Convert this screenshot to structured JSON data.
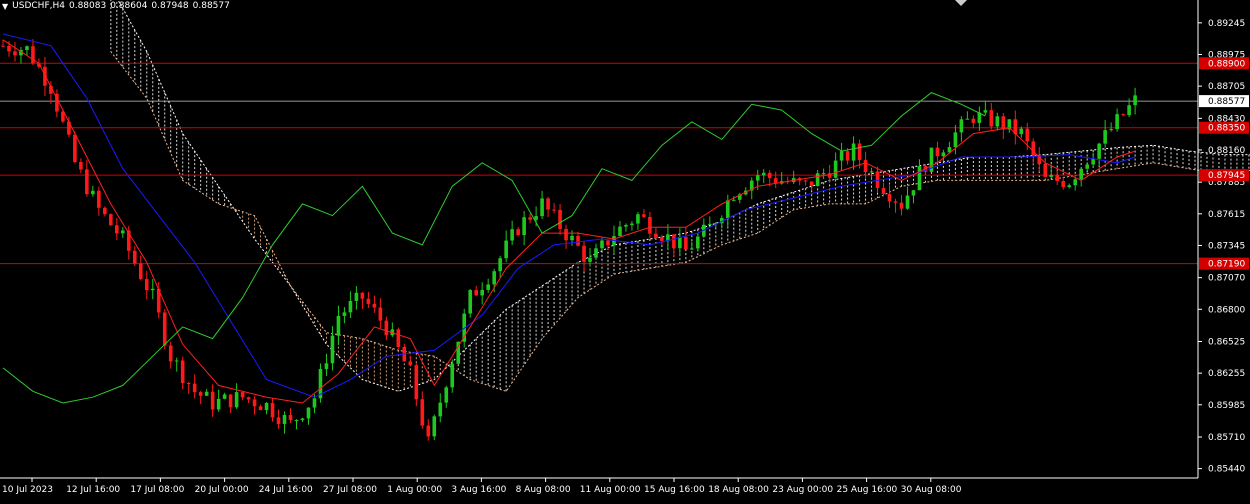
{
  "header": {
    "symbol": "USDCHF,H4",
    "open": "0.88083",
    "high": "0.88604",
    "low": "0.87948",
    "close": "0.88577"
  },
  "colors": {
    "background": "#000000",
    "bull_candle": "#1ec81e",
    "bear_candle": "#ff1a1a",
    "tenkan": "#ff2020",
    "kijun": "#1a1aff",
    "chikou": "#2ecc2e",
    "cloud_a": "#ffffff",
    "cloud_b": "#f0b68a",
    "level_line": "#d40000",
    "current_price_line": "#c8c8c8",
    "axis": "#ffffff"
  },
  "chart_data": {
    "type": "candlestick",
    "symbol": "USDCHF",
    "timeframe": "H4",
    "ylim": [
      0.8536,
      0.8944
    ],
    "y_ticks": [
      "0.89245",
      "0.88975",
      "0.88705",
      "0.88430",
      "0.88160",
      "0.87885",
      "0.87615",
      "0.87345",
      "0.87070",
      "0.86800",
      "0.86525",
      "0.86255",
      "0.85985",
      "0.85710",
      "0.85440"
    ],
    "x_tick_labels": [
      "10 Jul 2023",
      "12 Jul 16:00",
      "17 Jul 08:00",
      "20 Jul 00:00",
      "24 Jul 16:00",
      "27 Jul 08:00",
      "1 Aug 00:00",
      "3 Aug 16:00",
      "8 Aug 08:00",
      "11 Aug 00:00",
      "15 Aug 16:00",
      "18 Aug 08:00",
      "23 Aug 00:00",
      "25 Aug 16:00",
      "30 Aug 08:00"
    ],
    "horizontal_levels": [
      {
        "label": "0.88900",
        "value": 0.889,
        "color": "#d40000"
      },
      {
        "label": "0.88350",
        "value": 0.8835,
        "color": "#d40000"
      },
      {
        "label": "0.87945",
        "value": 0.87945,
        "color": "#d40000"
      },
      {
        "label": "0.87190",
        "value": 0.8719,
        "color": "#d40000"
      }
    ],
    "current_price": {
      "label": "0.88577",
      "value": 0.88577
    },
    "price_path": [
      [
        0,
        0.8905
      ],
      [
        4,
        0.8902
      ],
      [
        8,
        0.887
      ],
      [
        12,
        0.8805
      ],
      [
        16,
        0.8765
      ],
      [
        20,
        0.874
      ],
      [
        25,
        0.869
      ],
      [
        28,
        0.864
      ],
      [
        32,
        0.861
      ],
      [
        35,
        0.86
      ],
      [
        40,
        0.8605
      ],
      [
        44,
        0.8598
      ],
      [
        48,
        0.8582
      ],
      [
        52,
        0.8605
      ],
      [
        56,
        0.8675
      ],
      [
        60,
        0.869
      ],
      [
        64,
        0.8665
      ],
      [
        68,
        0.8625
      ],
      [
        71,
        0.8565
      ],
      [
        74,
        0.862
      ],
      [
        78,
        0.869
      ],
      [
        82,
        0.8715
      ],
      [
        86,
        0.875
      ],
      [
        90,
        0.877
      ],
      [
        94,
        0.8745
      ],
      [
        98,
        0.872
      ],
      [
        102,
        0.8745
      ],
      [
        106,
        0.876
      ],
      [
        110,
        0.8745
      ],
      [
        114,
        0.873
      ],
      [
        118,
        0.875
      ],
      [
        122,
        0.878
      ],
      [
        126,
        0.8795
      ],
      [
        130,
        0.879
      ],
      [
        134,
        0.8785
      ],
      [
        138,
        0.88
      ],
      [
        142,
        0.8815
      ],
      [
        146,
        0.879
      ],
      [
        150,
        0.877
      ],
      [
        154,
        0.8805
      ],
      [
        158,
        0.8825
      ],
      [
        162,
        0.8845
      ],
      [
        166,
        0.884
      ],
      [
        170,
        0.883
      ],
      [
        174,
        0.879
      ],
      [
        178,
        0.879
      ],
      [
        182,
        0.8815
      ],
      [
        186,
        0.884
      ],
      [
        189,
        0.8858
      ]
    ],
    "tenkan": [
      [
        0,
        0.891
      ],
      [
        6,
        0.889
      ],
      [
        12,
        0.883
      ],
      [
        18,
        0.877
      ],
      [
        24,
        0.872
      ],
      [
        30,
        0.865
      ],
      [
        36,
        0.8615
      ],
      [
        44,
        0.8605
      ],
      [
        50,
        0.86
      ],
      [
        56,
        0.8625
      ],
      [
        62,
        0.8665
      ],
      [
        68,
        0.8655
      ],
      [
        72,
        0.8615
      ],
      [
        78,
        0.8665
      ],
      [
        84,
        0.8715
      ],
      [
        90,
        0.8745
      ],
      [
        96,
        0.8745
      ],
      [
        102,
        0.874
      ],
      [
        108,
        0.875
      ],
      [
        114,
        0.875
      ],
      [
        120,
        0.877
      ],
      [
        126,
        0.8785
      ],
      [
        132,
        0.879
      ],
      [
        138,
        0.8795
      ],
      [
        144,
        0.8805
      ],
      [
        150,
        0.879
      ],
      [
        156,
        0.8805
      ],
      [
        162,
        0.883
      ],
      [
        168,
        0.8835
      ],
      [
        174,
        0.8805
      ],
      [
        180,
        0.879
      ],
      [
        186,
        0.881
      ],
      [
        189,
        0.8815
      ]
    ],
    "kijun": [
      [
        0,
        0.8915
      ],
      [
        8,
        0.8905
      ],
      [
        14,
        0.886
      ],
      [
        20,
        0.88
      ],
      [
        26,
        0.876
      ],
      [
        32,
        0.872
      ],
      [
        38,
        0.867
      ],
      [
        44,
        0.862
      ],
      [
        52,
        0.8605
      ],
      [
        58,
        0.862
      ],
      [
        64,
        0.864
      ],
      [
        72,
        0.8645
      ],
      [
        80,
        0.8675
      ],
      [
        86,
        0.8715
      ],
      [
        92,
        0.8735
      ],
      [
        100,
        0.874
      ],
      [
        108,
        0.8735
      ],
      [
        116,
        0.8745
      ],
      [
        124,
        0.8765
      ],
      [
        132,
        0.8775
      ],
      [
        140,
        0.8785
      ],
      [
        146,
        0.879
      ],
      [
        152,
        0.8795
      ],
      [
        160,
        0.881
      ],
      [
        170,
        0.881
      ],
      [
        178,
        0.8812
      ],
      [
        186,
        0.8805
      ],
      [
        189,
        0.881
      ]
    ],
    "chikou": [
      [
        0,
        0.863
      ],
      [
        5,
        0.861
      ],
      [
        10,
        0.86
      ],
      [
        15,
        0.8605
      ],
      [
        20,
        0.8615
      ],
      [
        25,
        0.864
      ],
      [
        30,
        0.8665
      ],
      [
        35,
        0.8655
      ],
      [
        40,
        0.869
      ],
      [
        45,
        0.8735
      ],
      [
        50,
        0.877
      ],
      [
        55,
        0.876
      ],
      [
        60,
        0.8785
      ],
      [
        65,
        0.8745
      ],
      [
        70,
        0.8735
      ],
      [
        75,
        0.8785
      ],
      [
        80,
        0.8805
      ],
      [
        85,
        0.879
      ],
      [
        90,
        0.8745
      ],
      [
        95,
        0.876
      ],
      [
        100,
        0.88
      ],
      [
        105,
        0.879
      ],
      [
        110,
        0.882
      ],
      [
        115,
        0.884
      ],
      [
        120,
        0.8825
      ],
      [
        125,
        0.8855
      ],
      [
        130,
        0.885
      ],
      [
        135,
        0.883
      ],
      [
        140,
        0.8815
      ],
      [
        145,
        0.882
      ],
      [
        150,
        0.8845
      ],
      [
        155,
        0.8865
      ],
      [
        160,
        0.8855
      ],
      [
        164,
        0.8845
      ]
    ],
    "senkou_a": [
      [
        18,
        0.8955
      ],
      [
        24,
        0.89
      ],
      [
        30,
        0.883
      ],
      [
        36,
        0.8785
      ],
      [
        42,
        0.874
      ],
      [
        48,
        0.87
      ],
      [
        54,
        0.865
      ],
      [
        60,
        0.862
      ],
      [
        66,
        0.861
      ],
      [
        72,
        0.862
      ],
      [
        78,
        0.865
      ],
      [
        84,
        0.868
      ],
      [
        90,
        0.87
      ],
      [
        96,
        0.872
      ],
      [
        102,
        0.8735
      ],
      [
        108,
        0.874
      ],
      [
        114,
        0.8745
      ],
      [
        120,
        0.8755
      ],
      [
        126,
        0.877
      ],
      [
        132,
        0.878
      ],
      [
        138,
        0.879
      ],
      [
        144,
        0.8795
      ],
      [
        150,
        0.88
      ],
      [
        156,
        0.8805
      ],
      [
        162,
        0.881
      ],
      [
        168,
        0.881
      ],
      [
        174,
        0.8812
      ],
      [
        180,
        0.8815
      ],
      [
        186,
        0.8818
      ],
      [
        192,
        0.882
      ],
      [
        198,
        0.8815
      ],
      [
        204,
        0.8812
      ],
      [
        210,
        0.8812
      ]
    ],
    "senkou_b": [
      [
        18,
        0.89
      ],
      [
        24,
        0.886
      ],
      [
        30,
        0.879
      ],
      [
        36,
        0.877
      ],
      [
        42,
        0.876
      ],
      [
        48,
        0.87
      ],
      [
        54,
        0.866
      ],
      [
        60,
        0.8655
      ],
      [
        66,
        0.8645
      ],
      [
        72,
        0.864
      ],
      [
        78,
        0.862
      ],
      [
        84,
        0.861
      ],
      [
        90,
        0.8655
      ],
      [
        96,
        0.869
      ],
      [
        102,
        0.871
      ],
      [
        108,
        0.8715
      ],
      [
        114,
        0.872
      ],
      [
        120,
        0.8735
      ],
      [
        126,
        0.8745
      ],
      [
        132,
        0.8765
      ],
      [
        138,
        0.877
      ],
      [
        144,
        0.877
      ],
      [
        150,
        0.8785
      ],
      [
        156,
        0.879
      ],
      [
        162,
        0.879
      ],
      [
        168,
        0.879
      ],
      [
        174,
        0.879
      ],
      [
        180,
        0.8795
      ],
      [
        186,
        0.88
      ],
      [
        192,
        0.8805
      ],
      [
        198,
        0.88
      ],
      [
        204,
        0.8795
      ],
      [
        210,
        0.88
      ]
    ]
  }
}
